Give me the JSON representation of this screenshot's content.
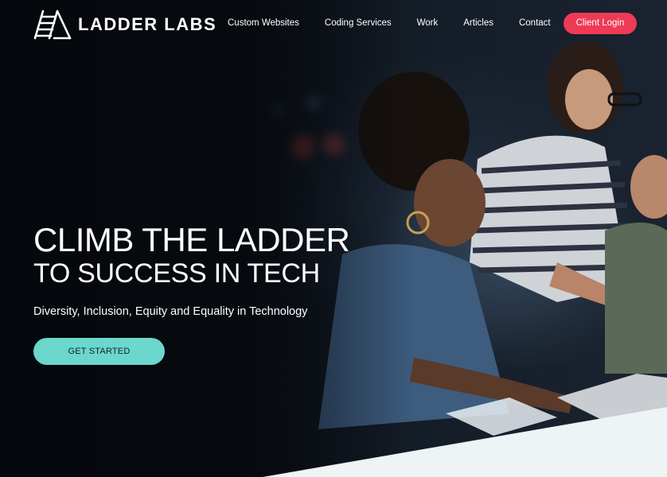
{
  "brand": {
    "name": "LADDER LABS",
    "logo_icon": "ladder-logo-icon"
  },
  "nav": {
    "items": [
      {
        "label": "Custom Websites"
      },
      {
        "label": "Coding Services"
      },
      {
        "label": "Work"
      },
      {
        "label": "Articles"
      },
      {
        "label": "Contact"
      }
    ],
    "login_label": "Client Login"
  },
  "hero": {
    "title": "CLIMB THE LADDER",
    "subtitle": "TO SUCCESS IN TECH",
    "tagline": "Diversity, Inclusion, Equity and Equality in Technology",
    "cta_label": "GET STARTED"
  },
  "colors": {
    "accent_login": "#ef3a56",
    "accent_cta": "#6cd7cc",
    "background": "#0b0f14",
    "bottom_band": "#eef3f6"
  }
}
